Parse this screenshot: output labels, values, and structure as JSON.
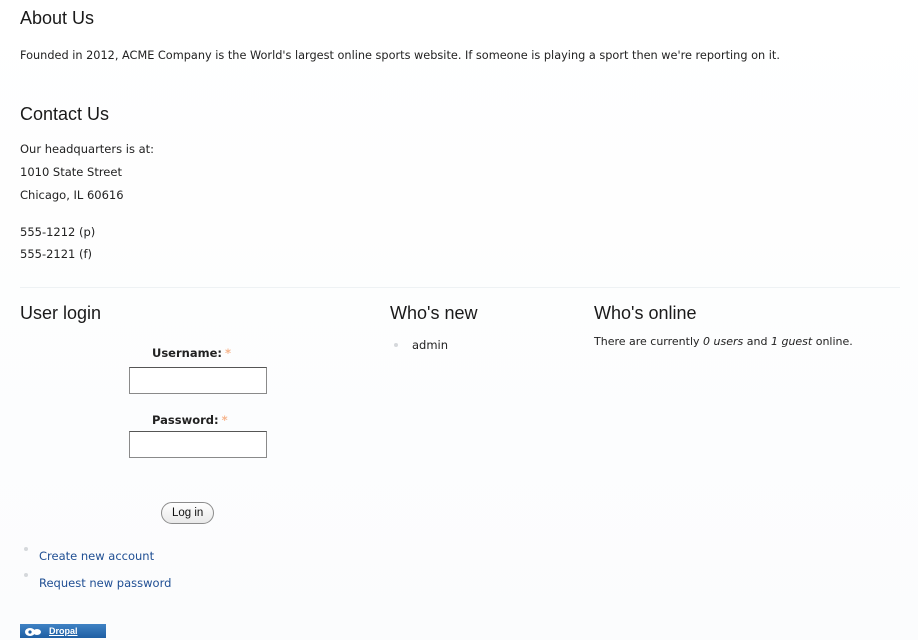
{
  "about": {
    "heading": "About Us",
    "body": "Founded in 2012, ACME Company is the World's largest online sports website. If someone is playing a sport then we're reporting on it."
  },
  "contact": {
    "heading": "Contact Us",
    "intro": "Our headquarters is at:",
    "street": "1010 State Street",
    "city": "Chicago, IL 60616",
    "phone": "555-1212 (p)",
    "fax": "555-2121 (f)"
  },
  "login": {
    "heading": "User login",
    "username_label": "Username:",
    "password_label": "Password:",
    "required_marker": "*",
    "username_value": "",
    "password_value": "",
    "submit_label": "Log in",
    "links": [
      {
        "label": "Create new account"
      },
      {
        "label": "Request new password"
      }
    ]
  },
  "whos_new": {
    "heading": "Who's new",
    "users": [
      "admin"
    ]
  },
  "whos_online": {
    "heading": "Who's online",
    "prefix": "There are currently ",
    "users_count": "0 users",
    "middle": " and ",
    "guests_count": "1 guest",
    "suffix": " online."
  },
  "footer": {
    "badge_label": "Dropal",
    "badge_color": "#2a6db4"
  },
  "colors": {
    "link": "#1f4e93",
    "required": "#f6b48c"
  }
}
